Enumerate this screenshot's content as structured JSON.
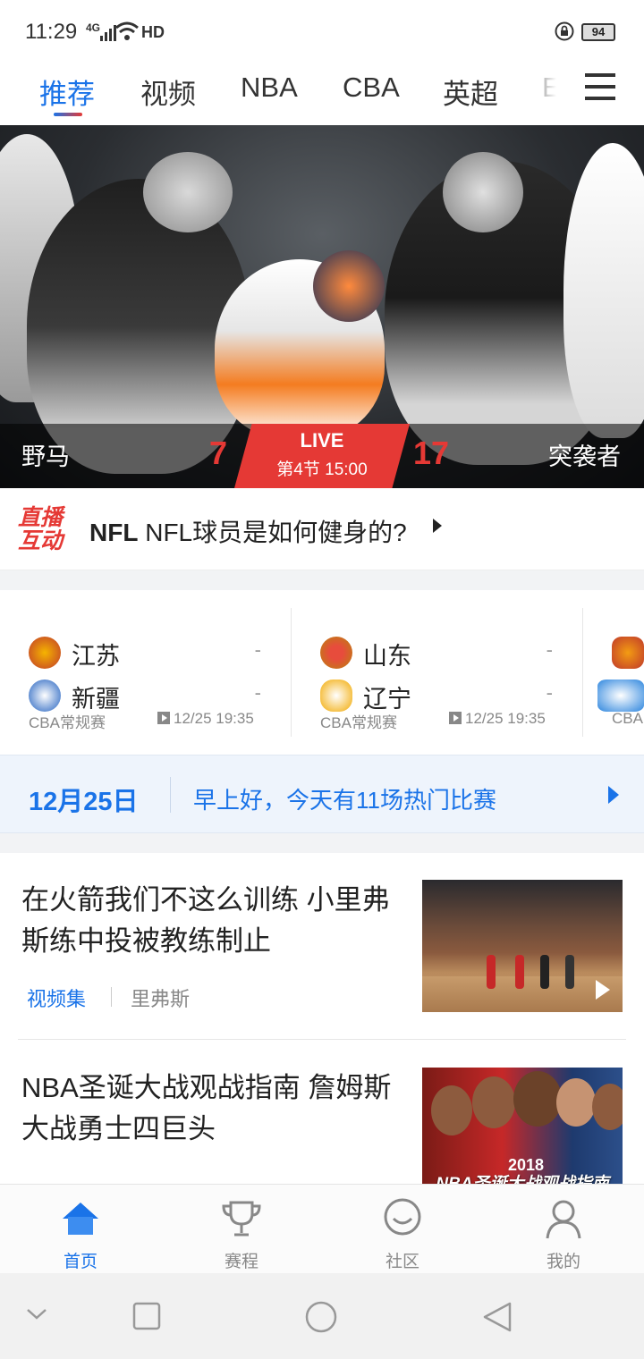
{
  "status_bar": {
    "time": "11:29",
    "network": "4G",
    "hd": "HD",
    "battery": "94"
  },
  "tabs": [
    {
      "label": "推荐",
      "active": true
    },
    {
      "label": "视频"
    },
    {
      "label": "NBA"
    },
    {
      "label": "CBA"
    },
    {
      "label": "英超"
    },
    {
      "label": "E"
    }
  ],
  "hero": {
    "team_left": "野马",
    "team_right": "突袭者",
    "score_left": "7",
    "score_right": "17",
    "live_label": "LIVE",
    "period": "第4节 15:00"
  },
  "interact": {
    "logo_line1": "直播",
    "logo_line2": "互动",
    "league": "NFL",
    "text": "NFL球员是如何健身的?"
  },
  "matches": [
    {
      "home": {
        "name": "江苏",
        "score": "-"
      },
      "away": {
        "name": "新疆",
        "score": "-"
      },
      "league": "CBA常规赛",
      "time": "12/25 19:35"
    },
    {
      "home": {
        "name": "山东",
        "score": "-"
      },
      "away": {
        "name": "辽宁",
        "score": "-"
      },
      "league": "CBA常规赛",
      "time": "12/25 19:35"
    },
    {
      "league": "CBA"
    }
  ],
  "date_banner": {
    "date": "12月25日",
    "message": "早上好，今天有11场热门比赛"
  },
  "news": [
    {
      "title": "在火箭我们不这么训练 小里弗斯练中投被教练制止",
      "tag": "视频集",
      "source": "里弗斯"
    },
    {
      "title": "NBA圣诞大战观战指南 詹姆斯大战勇士四巨头",
      "thumb_caption": "NBA圣诞大战观战指南",
      "thumb_year": "2018"
    }
  ],
  "bottom_nav": [
    {
      "label": "首页",
      "icon": "home-icon",
      "active": true
    },
    {
      "label": "赛程",
      "icon": "trophy-icon"
    },
    {
      "label": "社区",
      "icon": "chat-icon"
    },
    {
      "label": "我的",
      "icon": "profile-icon"
    }
  ],
  "colors": {
    "accent": "#1a73e8",
    "live_red": "#e53935"
  }
}
